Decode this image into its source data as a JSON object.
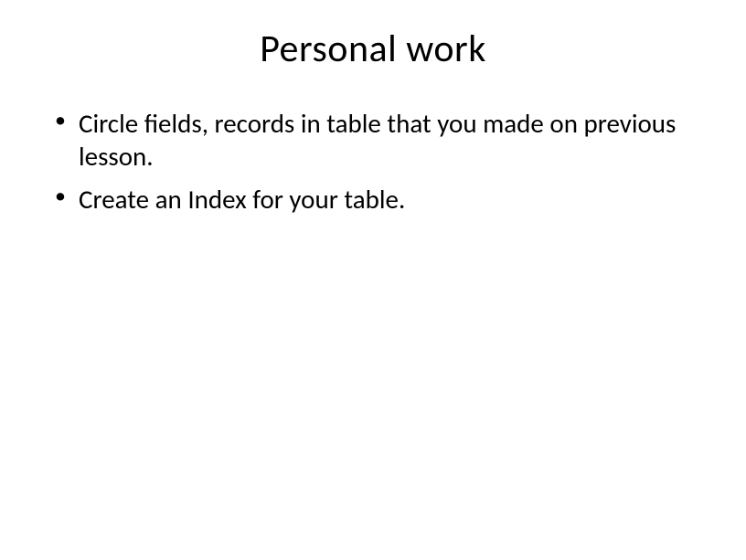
{
  "slide": {
    "title": "Personal work",
    "bullets": [
      "Circle fields, records in table that you made on previous lesson.",
      "Create an Index for your table."
    ]
  }
}
